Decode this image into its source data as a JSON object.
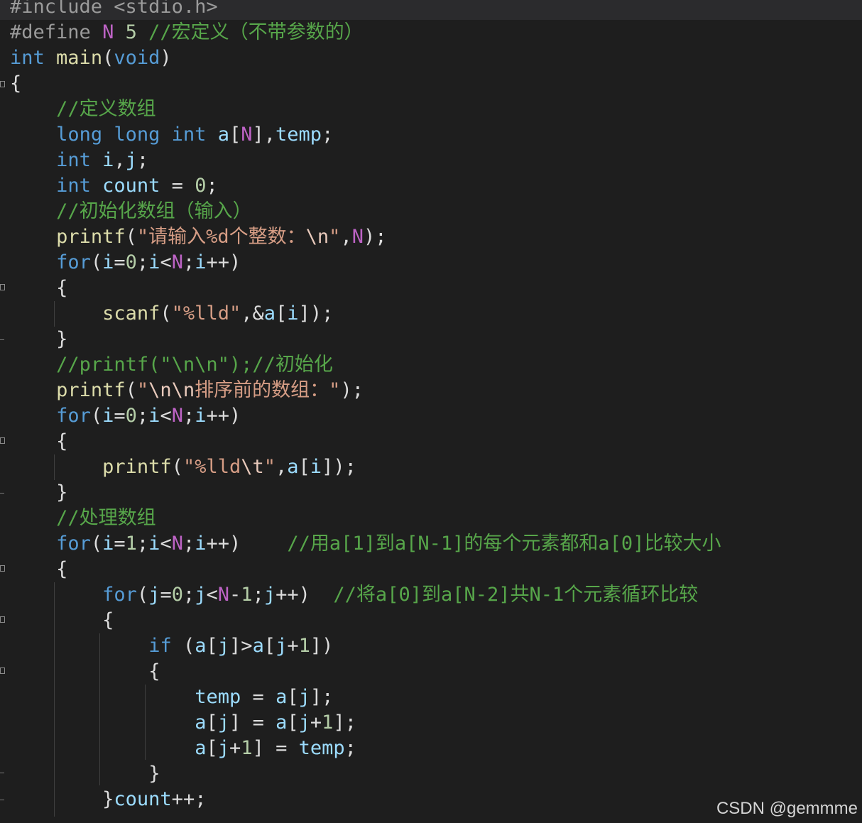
{
  "editor": {
    "language": "C",
    "lines": [
      "#include <stdio.h>",
      "#define N 5 //宏定义（不带参数的）",
      "int main(void)",
      "{",
      "    //定义数组",
      "    long long int a[N],temp;",
      "    int i,j;",
      "    int count = 0;",
      "    //初始化数组（输入）",
      "    printf(\"请输入%d个整数：\\n\",N);",
      "    for(i=0;i<N;i++)",
      "    {",
      "        scanf(\"%lld\",&a[i]);",
      "    }",
      "    //printf(\"\\n\\n\");//初始化",
      "    printf(\"\\n\\n排序前的数组：\");",
      "    for(i=0;i<N;i++)",
      "    {",
      "        printf(\"%lld\\t\",a[i]);",
      "    }",
      "    //处理数组",
      "    for(i=1;i<N;i++)    //用a[1]到a[N-1]的每个元素都和a[0]比较大小",
      "    {",
      "        for(j=0;j<N-1;j++)  //将a[0]到a[N-2]共N-1个元素循环比较",
      "        {",
      "            if (a[j]>a[j+1])",
      "            {",
      "                temp = a[j];",
      "                a[j] = a[j+1];",
      "                a[j+1] = temp;",
      "            }",
      "        }count++;"
    ]
  },
  "watermark": "CSDN @gemmme",
  "colors": {
    "background": "#1e1e1e",
    "keyword": "#569cd6",
    "comment": "#57a64a",
    "string": "#d69d85",
    "macro": "#bd63c5",
    "function": "#dcdcaa",
    "variable": "#9cdcfe"
  }
}
